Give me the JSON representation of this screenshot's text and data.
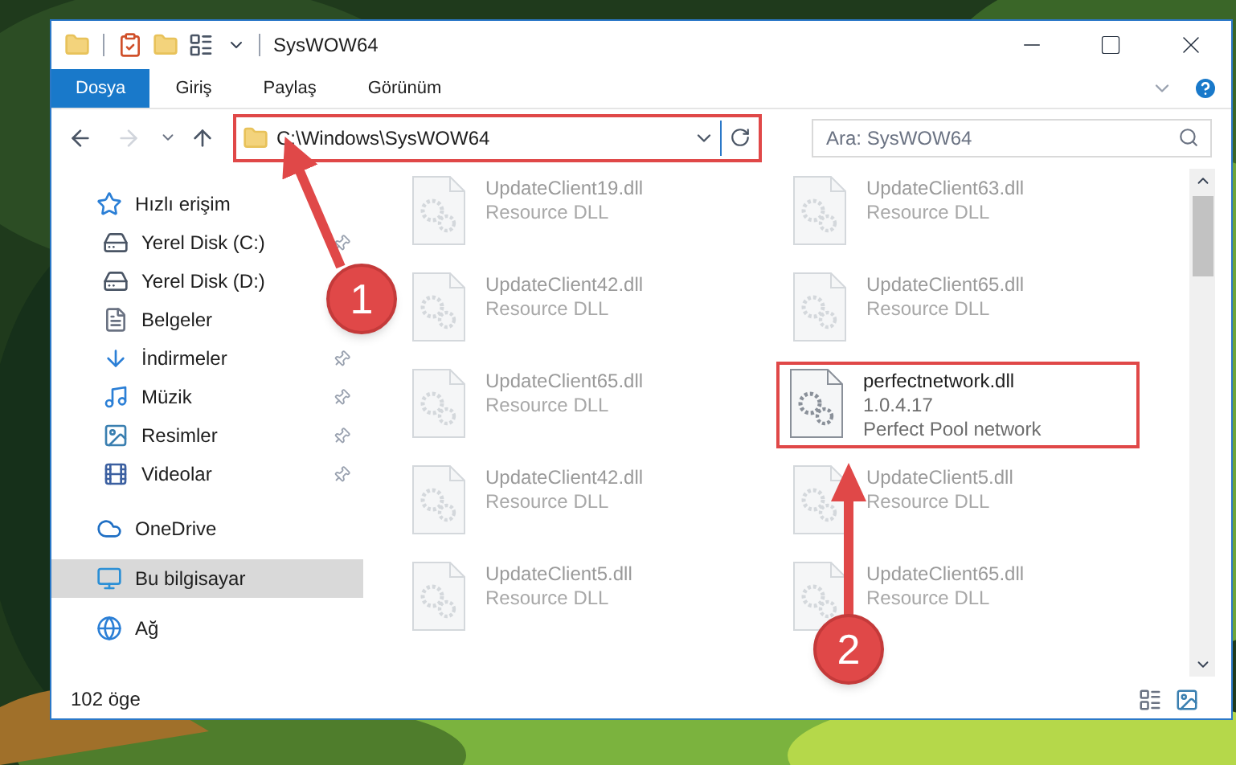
{
  "window": {
    "title": "SysWOW64"
  },
  "ribbon_tabs": [
    {
      "label": "Dosya",
      "selected": true
    },
    {
      "label": "Giriş",
      "selected": false
    },
    {
      "label": "Paylaş",
      "selected": false
    },
    {
      "label": "Görünüm",
      "selected": false
    }
  ],
  "address": {
    "path": "C:\\Windows\\SysWOW64",
    "highlighted": true
  },
  "search": {
    "placeholder": "Ara: SysWOW64"
  },
  "sidebar": {
    "items": [
      {
        "label": "Hızlı erişim",
        "kind": "star",
        "selected": false,
        "children": [
          {
            "label": "Yerel Disk (C:)",
            "kind": "drive",
            "pinned": true,
            "selected": false
          },
          {
            "label": "Yerel Disk (D:)",
            "kind": "drive",
            "pinned": false,
            "selected": false
          },
          {
            "label": "Belgeler",
            "kind": "documents",
            "pinned": false,
            "selected": false
          },
          {
            "label": "İndirmeler",
            "kind": "downloads",
            "pinned": true,
            "selected": false
          },
          {
            "label": "Müzik",
            "kind": "music",
            "pinned": true,
            "selected": false
          },
          {
            "label": "Resimler",
            "kind": "pictures",
            "pinned": true,
            "selected": false
          },
          {
            "label": "Videolar",
            "kind": "videos",
            "pinned": true,
            "selected": false
          }
        ]
      },
      {
        "label": "OneDrive",
        "kind": "cloud",
        "selected": false
      },
      {
        "label": "Bu bilgisayar",
        "kind": "computer",
        "selected": true
      },
      {
        "label": "Ağ",
        "kind": "network",
        "selected": false
      }
    ]
  },
  "files": [
    {
      "name": "UpdateClient19.dll",
      "details": [
        "Resource DLL"
      ],
      "dimmed": true,
      "highlighted": false
    },
    {
      "name": "UpdateClient63.dll",
      "details": [
        "Resource DLL"
      ],
      "dimmed": true,
      "highlighted": false
    },
    {
      "name": "UpdateClient42.dll",
      "details": [
        "Resource DLL"
      ],
      "dimmed": true,
      "highlighted": false
    },
    {
      "name": "UpdateClient65.dll",
      "details": [
        "Resource DLL"
      ],
      "dimmed": true,
      "highlighted": false
    },
    {
      "name": "UpdateClient65.dll",
      "details": [
        "Resource DLL"
      ],
      "dimmed": true,
      "highlighted": false
    },
    {
      "name": "perfectnetwork.dll",
      "details": [
        "1.0.4.17",
        "Perfect Pool network"
      ],
      "dimmed": false,
      "highlighted": true
    },
    {
      "name": "UpdateClient42.dll",
      "details": [
        "Resource DLL"
      ],
      "dimmed": true,
      "highlighted": false
    },
    {
      "name": "UpdateClient5.dll",
      "details": [
        "Resource DLL"
      ],
      "dimmed": true,
      "highlighted": false
    },
    {
      "name": "UpdateClient5.dll",
      "details": [
        "Resource DLL"
      ],
      "dimmed": true,
      "highlighted": false
    },
    {
      "name": "UpdateClient65.dll",
      "details": [
        "Resource DLL"
      ],
      "dimmed": true,
      "highlighted": false
    }
  ],
  "annotations": [
    {
      "number": "1"
    },
    {
      "number": "2"
    }
  ],
  "status_bar": {
    "count": "102 öge"
  }
}
